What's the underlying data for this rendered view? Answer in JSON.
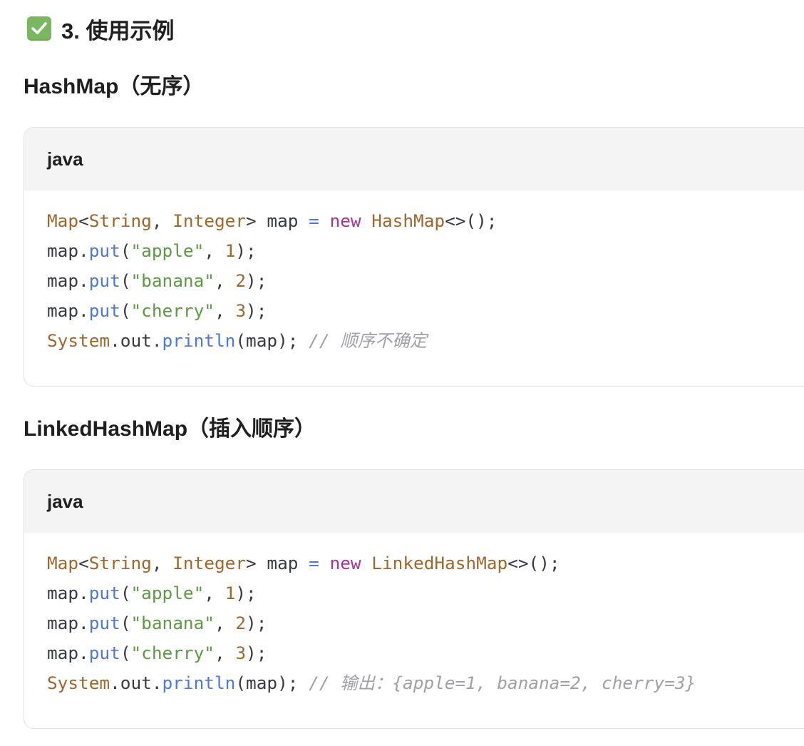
{
  "section": {
    "icon": "check-mark-button-icon",
    "title": "3. 使用示例"
  },
  "examples": [
    {
      "heading": "HashMap（无序）",
      "language": "java",
      "lines": [
        [
          {
            "t": "Map",
            "k": "type"
          },
          {
            "t": "<",
            "k": "plain"
          },
          {
            "t": "String",
            "k": "type"
          },
          {
            "t": ", ",
            "k": "plain"
          },
          {
            "t": "Integer",
            "k": "type"
          },
          {
            "t": "> map ",
            "k": "plain"
          },
          {
            "t": "=",
            "k": "op"
          },
          {
            "t": " ",
            "k": "plain"
          },
          {
            "t": "new",
            "k": "kw"
          },
          {
            "t": " ",
            "k": "plain"
          },
          {
            "t": "HashMap",
            "k": "type"
          },
          {
            "t": "<>();",
            "k": "plain"
          }
        ],
        [
          {
            "t": "map.",
            "k": "plain"
          },
          {
            "t": "put",
            "k": "fn"
          },
          {
            "t": "(",
            "k": "plain"
          },
          {
            "t": "\"apple\"",
            "k": "str"
          },
          {
            "t": ", ",
            "k": "plain"
          },
          {
            "t": "1",
            "k": "num"
          },
          {
            "t": ");",
            "k": "plain"
          }
        ],
        [
          {
            "t": "map.",
            "k": "plain"
          },
          {
            "t": "put",
            "k": "fn"
          },
          {
            "t": "(",
            "k": "plain"
          },
          {
            "t": "\"banana\"",
            "k": "str"
          },
          {
            "t": ", ",
            "k": "plain"
          },
          {
            "t": "2",
            "k": "num"
          },
          {
            "t": ");",
            "k": "plain"
          }
        ],
        [
          {
            "t": "map.",
            "k": "plain"
          },
          {
            "t": "put",
            "k": "fn"
          },
          {
            "t": "(",
            "k": "plain"
          },
          {
            "t": "\"cherry\"",
            "k": "str"
          },
          {
            "t": ", ",
            "k": "plain"
          },
          {
            "t": "3",
            "k": "num"
          },
          {
            "t": ");",
            "k": "plain"
          }
        ],
        [
          {
            "t": "System",
            "k": "type"
          },
          {
            "t": ".out.",
            "k": "plain"
          },
          {
            "t": "println",
            "k": "fn"
          },
          {
            "t": "(map); ",
            "k": "plain"
          },
          {
            "t": "// 顺序不确定",
            "k": "cm"
          }
        ]
      ]
    },
    {
      "heading": "LinkedHashMap（插入顺序）",
      "language": "java",
      "lines": [
        [
          {
            "t": "Map",
            "k": "type"
          },
          {
            "t": "<",
            "k": "plain"
          },
          {
            "t": "String",
            "k": "type"
          },
          {
            "t": ", ",
            "k": "plain"
          },
          {
            "t": "Integer",
            "k": "type"
          },
          {
            "t": "> map ",
            "k": "plain"
          },
          {
            "t": "=",
            "k": "op"
          },
          {
            "t": " ",
            "k": "plain"
          },
          {
            "t": "new",
            "k": "kw"
          },
          {
            "t": " ",
            "k": "plain"
          },
          {
            "t": "LinkedHashMap",
            "k": "type"
          },
          {
            "t": "<>();",
            "k": "plain"
          }
        ],
        [
          {
            "t": "map.",
            "k": "plain"
          },
          {
            "t": "put",
            "k": "fn"
          },
          {
            "t": "(",
            "k": "plain"
          },
          {
            "t": "\"apple\"",
            "k": "str"
          },
          {
            "t": ", ",
            "k": "plain"
          },
          {
            "t": "1",
            "k": "num"
          },
          {
            "t": ");",
            "k": "plain"
          }
        ],
        [
          {
            "t": "map.",
            "k": "plain"
          },
          {
            "t": "put",
            "k": "fn"
          },
          {
            "t": "(",
            "k": "plain"
          },
          {
            "t": "\"banana\"",
            "k": "str"
          },
          {
            "t": ", ",
            "k": "plain"
          },
          {
            "t": "2",
            "k": "num"
          },
          {
            "t": ");",
            "k": "plain"
          }
        ],
        [
          {
            "t": "map.",
            "k": "plain"
          },
          {
            "t": "put",
            "k": "fn"
          },
          {
            "t": "(",
            "k": "plain"
          },
          {
            "t": "\"cherry\"",
            "k": "str"
          },
          {
            "t": ", ",
            "k": "plain"
          },
          {
            "t": "3",
            "k": "num"
          },
          {
            "t": ");",
            "k": "plain"
          }
        ],
        [
          {
            "t": "System",
            "k": "type"
          },
          {
            "t": ".out.",
            "k": "plain"
          },
          {
            "t": "println",
            "k": "fn"
          },
          {
            "t": "(map); ",
            "k": "plain"
          },
          {
            "t": "// 输出：{apple=1, banana=2, cherry=3}",
            "k": "cm"
          }
        ]
      ]
    }
  ]
}
